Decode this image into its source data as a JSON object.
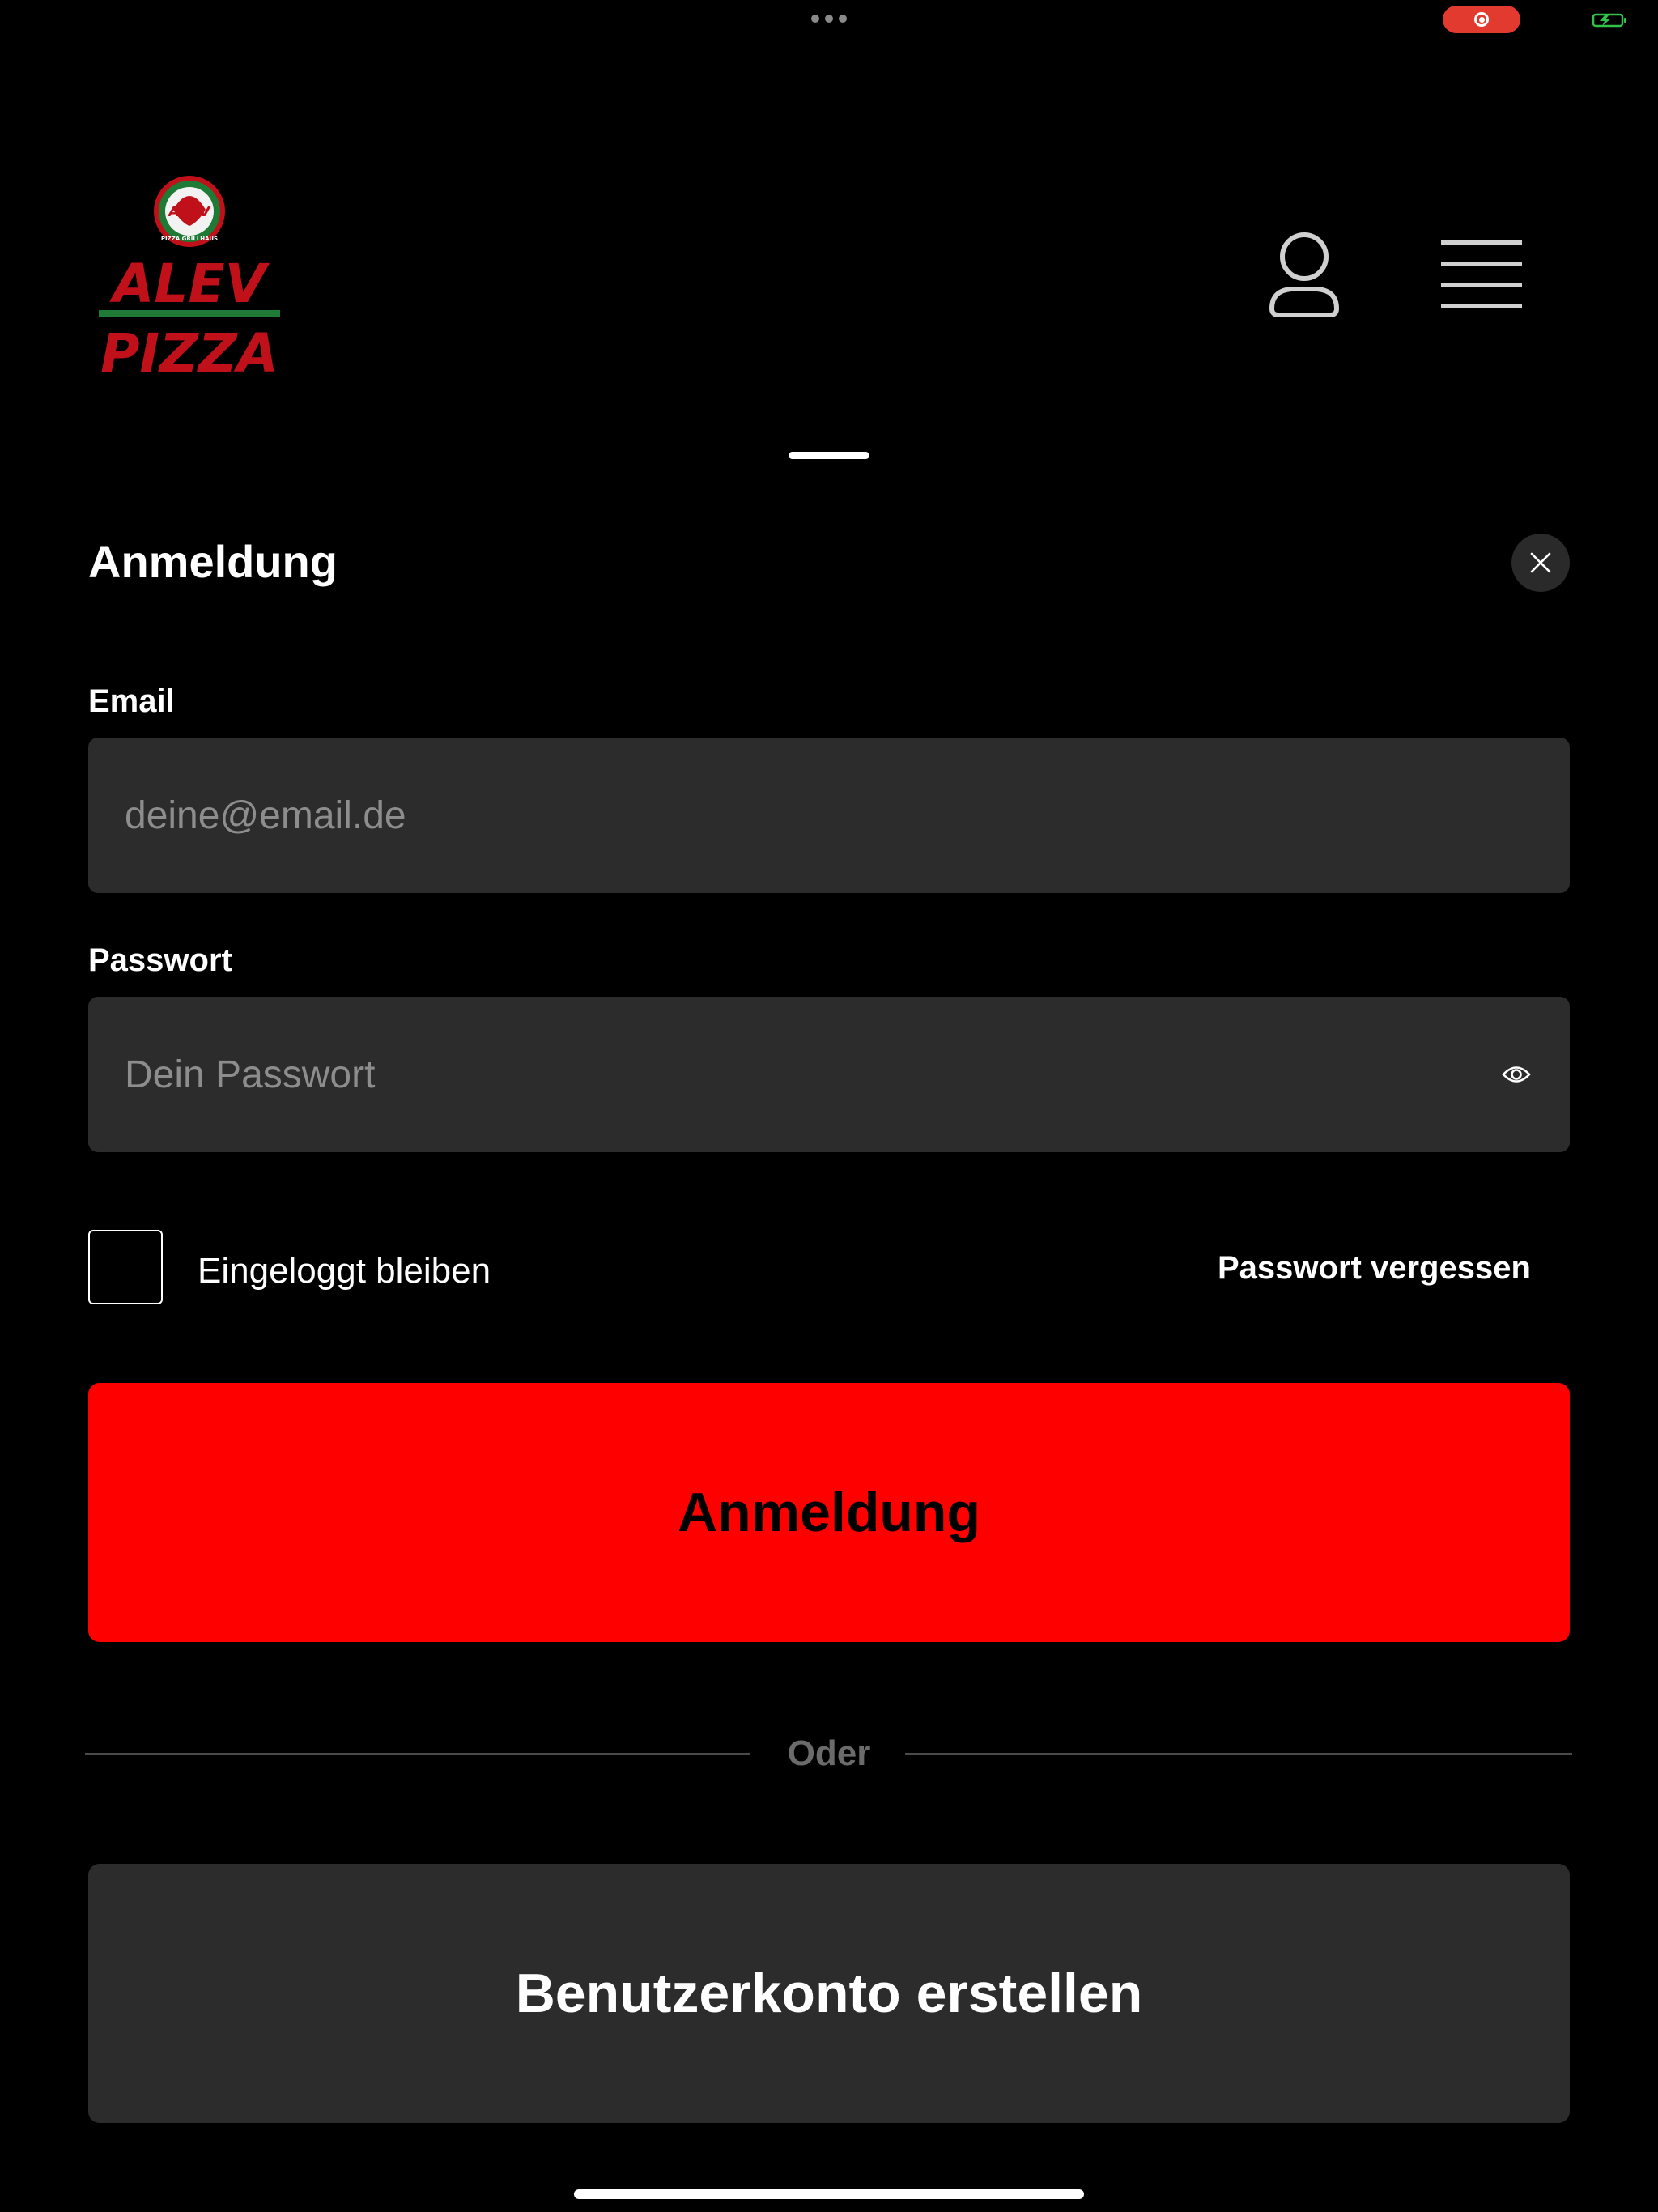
{
  "brand": {
    "name_line1": "ALEV",
    "name_line2": "PIZZA",
    "badge_text": "ALEV",
    "badge_subtext": "PIZZA GRILLHAUS",
    "colors": {
      "red": "#c0101a",
      "green": "#1e7a34",
      "accent": "#ff0000"
    }
  },
  "header": {
    "account_icon": "user-icon",
    "menu_icon": "hamburger-menu-icon"
  },
  "login": {
    "title": "Anmeldung",
    "close_icon": "close-icon",
    "email": {
      "label": "Email",
      "placeholder": "deine@email.de",
      "value": ""
    },
    "password": {
      "label": "Passwort",
      "placeholder": "Dein Passwort",
      "value": "",
      "toggle_icon": "eye-icon"
    },
    "remember_me": {
      "label": "Eingeloggt bleiben",
      "checked": false
    },
    "forgot_password_label": "Passwort vergessen",
    "submit_label": "Anmeldung",
    "divider_label": "Oder",
    "register_label": "Benutzerkonto erstellen"
  }
}
